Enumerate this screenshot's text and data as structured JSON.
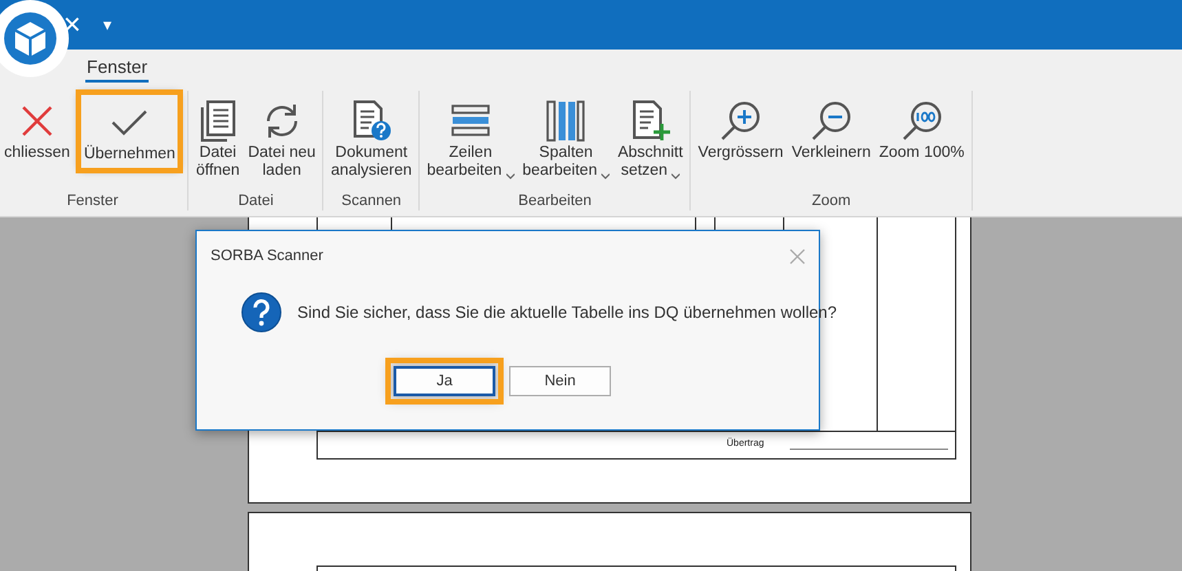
{
  "title_bar": {
    "close_glyph": "×",
    "menu_glyph": "▾"
  },
  "tabs": [
    {
      "label": "Fenster",
      "selected": true
    }
  ],
  "ribbon_groups": [
    {
      "label": "Fenster",
      "buttons": [
        {
          "label": "chliessen",
          "highlighted": false,
          "dropdown": false
        },
        {
          "label": "Übernehmen",
          "highlighted": true,
          "dropdown": false
        }
      ]
    },
    {
      "label": "Datei",
      "buttons": [
        {
          "label": "Datei\nöffnen",
          "highlighted": false,
          "dropdown": false
        },
        {
          "label": "Datei neu\nladen",
          "highlighted": false,
          "dropdown": false
        }
      ]
    },
    {
      "label": "Scannen",
      "buttons": [
        {
          "label": "Dokument\nanalysieren",
          "highlighted": false,
          "dropdown": false
        }
      ]
    },
    {
      "label": "Bearbeiten",
      "buttons": [
        {
          "label": "Zeilen\nbearbeiten",
          "highlighted": false,
          "dropdown": true
        },
        {
          "label": "Spalten\nbearbeiten",
          "highlighted": false,
          "dropdown": true
        },
        {
          "label": "Abschnitt\nsetzen",
          "highlighted": false,
          "dropdown": true
        }
      ]
    },
    {
      "label": "Zoom",
      "buttons": [
        {
          "label": "Vergrössern",
          "highlighted": false,
          "dropdown": false
        },
        {
          "label": "Verkleinern",
          "highlighted": false,
          "dropdown": false
        },
        {
          "label": "Zoom 100%",
          "highlighted": false,
          "dropdown": false
        }
      ]
    }
  ],
  "document": {
    "footer_label": "Übertrag"
  },
  "dialog": {
    "title": "SORBA Scanner",
    "message": "Sind Sie sicher, dass Sie die aktuelle Tabelle ins DQ übernehmen wollen?",
    "buttons": [
      {
        "label": "Ja",
        "highlighted": true
      },
      {
        "label": "Nein",
        "highlighted": false
      }
    ]
  }
}
